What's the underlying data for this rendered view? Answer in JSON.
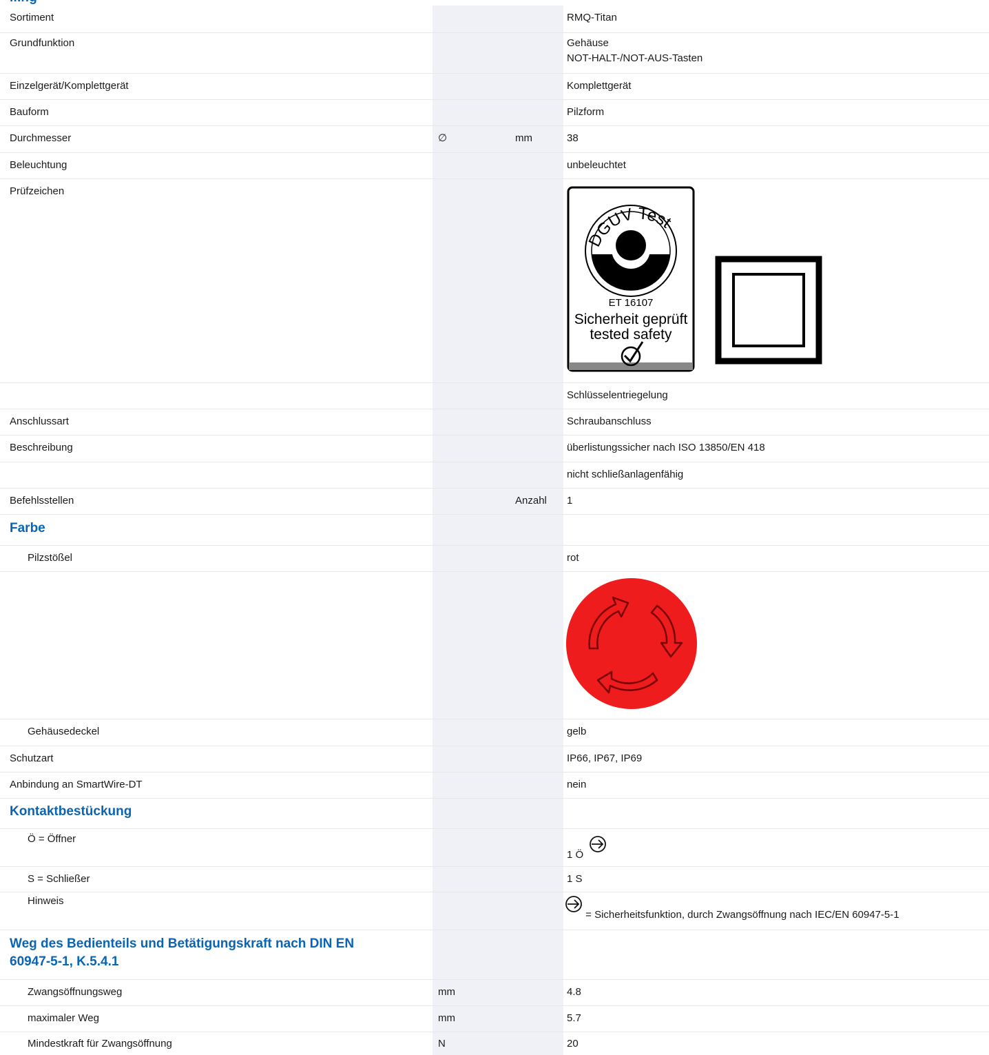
{
  "top_heading_fragment": "...ng",
  "rows": {
    "sortiment": {
      "label": "Sortiment",
      "value": "RMQ-Titan"
    },
    "grundfunktion": {
      "label": "Grundfunktion",
      "value1": "Gehäuse",
      "value2": "NOT-HALT-/NOT-AUS-Tasten"
    },
    "einzelgeraet": {
      "label": "Einzelgerät/Komplettgerät",
      "value": "Komplettgerät"
    },
    "bauform": {
      "label": "Bauform",
      "value": "Pilzform"
    },
    "durchmesser": {
      "label": "Durchmesser",
      "symbol": "∅",
      "unit": "mm",
      "value": "38"
    },
    "beleuchtung": {
      "label": "Beleuchtung",
      "value": "unbeleuchtet"
    },
    "pruefzeichen": {
      "label": "Prüfzeichen"
    },
    "schluessel": {
      "value": "Schlüsselentriegelung"
    },
    "anschlussart": {
      "label": "Anschlussart",
      "value": "Schraubanschluss"
    },
    "beschreibung": {
      "label": "Beschreibung",
      "value": "überlistungssicher nach ISO 13850/EN 418"
    },
    "schliessanlage": {
      "value": "nicht schließanlagenfähig"
    },
    "befehlsstellen": {
      "label": "Befehlsstellen",
      "unit": "Anzahl",
      "value": "1"
    }
  },
  "dguv_logo": {
    "top": "DGUV Test",
    "code": "ET 16107",
    "line1": "Sicherheit geprüft",
    "line2": "tested safety"
  },
  "farbe": {
    "heading": "Farbe",
    "pilzstoessel": {
      "label": "Pilzstößel",
      "value": "rot"
    },
    "gehaeusedeckel": {
      "label": "Gehäusedeckel",
      "value": "gelb"
    }
  },
  "rows2": {
    "schutzart": {
      "label": "Schutzart",
      "value": "IP66, IP67, IP69"
    },
    "smartwire": {
      "label": "Anbindung an SmartWire-DT",
      "value": "nein"
    }
  },
  "kontakt": {
    "heading": "Kontaktbestückung",
    "oeffner": {
      "label": "Ö = Öffner",
      "value": "1 Ö"
    },
    "schliesser": {
      "label": "S = Schließer",
      "value": "1 S"
    },
    "hinweis": {
      "label": "Hinweis",
      "value": "= Sicherheitsfunktion, durch Zwangsöffnung nach IEC/EN 60947-5-1"
    }
  },
  "weg": {
    "heading_line1": "Weg des Bedienteils und Betätigungskraft nach DIN EN",
    "heading_line2": "60947-5-1, K.5.4.1",
    "zwangsweg": {
      "label": "Zwangsöffnungsweg",
      "unit": "mm",
      "value": "4.8"
    },
    "maxweg": {
      "label": "maximaler Weg",
      "unit": "mm",
      "value": "5.7"
    },
    "mindestkraft": {
      "label": "Mindestkraft für Zwangsöffnung",
      "unit": "N",
      "value": "20"
    }
  },
  "colors": {
    "accent": "#0a64b4",
    "shade": "#eff1f6",
    "button_red": "#ee1c1c"
  }
}
